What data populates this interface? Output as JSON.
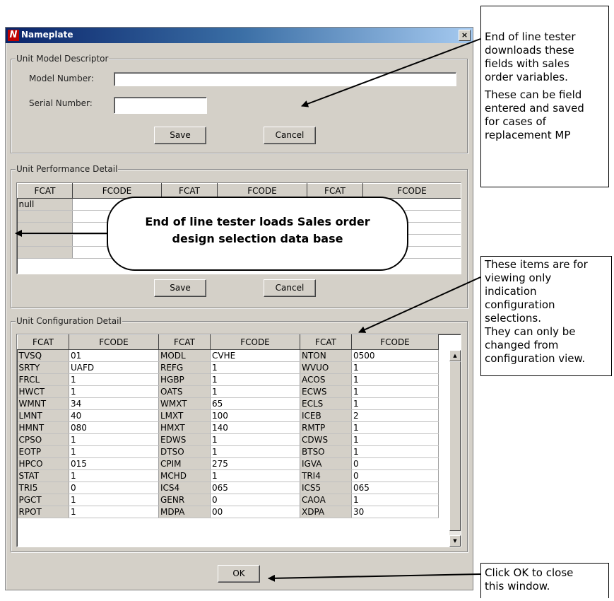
{
  "window": {
    "title": "Nameplate",
    "icon_letter": "N",
    "close_glyph": "×"
  },
  "model_group": {
    "legend": "Unit Model Descriptor",
    "model_label": "Model Number:",
    "model_value": "",
    "serial_label": "Serial Number:",
    "serial_value": "",
    "save_label": "Save",
    "cancel_label": "Cancel"
  },
  "perf_group": {
    "legend": "Unit Performance Detail",
    "headers": [
      "FCAT",
      "FCODE",
      "FCAT",
      "FCODE",
      "FCAT",
      "FCODE"
    ],
    "rows": [
      [
        "null",
        "",
        "",
        "",
        "",
        ""
      ],
      [
        "",
        "",
        "",
        "",
        "",
        ""
      ],
      [
        "",
        "",
        "",
        "",
        "",
        ""
      ],
      [
        "",
        "",
        "",
        "",
        "",
        ""
      ],
      [
        "",
        "",
        "",
        "",
        "",
        ""
      ]
    ],
    "save_label": "Save",
    "cancel_label": "Cancel"
  },
  "config_group": {
    "legend": "Unit Configuration Detail",
    "headers": [
      "FCAT",
      "FCODE",
      "FCAT",
      "FCODE",
      "FCAT",
      "FCODE"
    ],
    "rows": [
      [
        "TVSQ",
        "01",
        "MODL",
        "CVHE",
        "NTON",
        "0500"
      ],
      [
        "SRTY",
        "UAFD",
        "REFG",
        "1",
        "WVUO",
        "1"
      ],
      [
        "FRCL",
        "1",
        "HGBP",
        "1",
        "ACOS",
        "1"
      ],
      [
        "HWCT",
        "1",
        "OATS",
        "1",
        "ECWS",
        "1"
      ],
      [
        "WMNT",
        "34",
        "WMXT",
        "65",
        "ECLS",
        "1"
      ],
      [
        "LMNT",
        "40",
        "LMXT",
        "100",
        "ICEB",
        "2"
      ],
      [
        "HMNT",
        "080",
        "HMXT",
        "140",
        "RMTP",
        "1"
      ],
      [
        "CPSO",
        "1",
        "EDWS",
        "1",
        "CDWS",
        "1"
      ],
      [
        "EOTP",
        "1",
        "DTSO",
        "1",
        "BTSO",
        "1"
      ],
      [
        "HPCO",
        "015",
        "CPIM",
        "275",
        "IGVA",
        "0"
      ],
      [
        "STAT",
        "1",
        "MCHD",
        "1",
        "TRI4",
        "0"
      ],
      [
        "TRI5",
        "0",
        "ICS4",
        "065",
        "ICS5",
        "065"
      ],
      [
        "PGCT",
        "1",
        "GENR",
        "0",
        "CAOA",
        "1"
      ],
      [
        "RPOT",
        "1",
        "MDPA",
        "00",
        "XDPA",
        "30"
      ]
    ],
    "scroll_up": "▲",
    "scroll_down": "▼"
  },
  "ok_label": "OK",
  "annotations": {
    "note1_lines": [
      "End of line tester",
      "downloads these",
      "fields with sales",
      "order variables."
    ],
    "note1_lines2": [
      "These can be field",
      "entered and saved",
      "for cases of",
      "replacement MP"
    ],
    "callout_line1": "End of line tester loads Sales order",
    "callout_line2": "design selection data base",
    "note2_lines": [
      "These items are for",
      "viewing only",
      "indication",
      "configuration",
      "selections.",
      "They can only be",
      "changed from",
      "configuration view."
    ],
    "note3_lines": [
      "Click OK to close",
      "this window."
    ]
  }
}
